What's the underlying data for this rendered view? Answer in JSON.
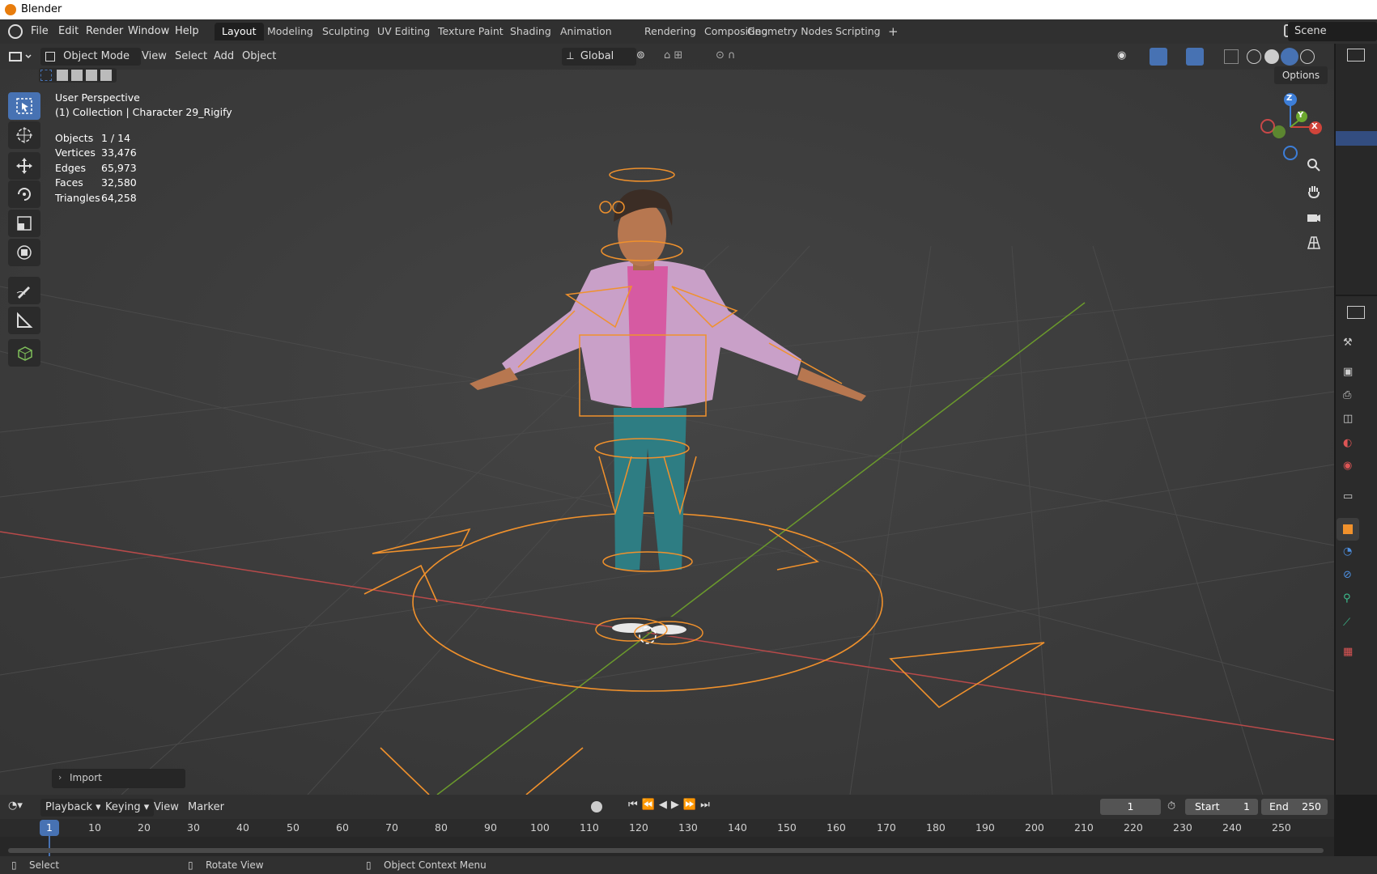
{
  "window": {
    "title": "Blender"
  },
  "menu": {
    "file": "File",
    "edit": "Edit",
    "render": "Render",
    "window": "Window",
    "help": "Help"
  },
  "workspaces": [
    "Layout",
    "Modeling",
    "Sculpting",
    "UV Editing",
    "Texture Paint",
    "Shading",
    "Animation",
    "Rendering",
    "Compositing",
    "Geometry Nodes",
    "Scripting"
  ],
  "add_workspace": "+",
  "scene": {
    "label": "Scene"
  },
  "viewport_header": {
    "mode": "Object Mode",
    "view": "View",
    "select": "Select",
    "add": "Add",
    "object": "Object",
    "orientation": "Global",
    "options": "Options"
  },
  "overlay_info": {
    "perspective": "User Perspective",
    "collection": "(1) Collection | Character 29_Rigify",
    "stats": [
      {
        "label": "Objects",
        "value": "1 / 14"
      },
      {
        "label": "Vertices",
        "value": "33,476"
      },
      {
        "label": "Edges",
        "value": "65,973"
      },
      {
        "label": "Faces",
        "value": "32,580"
      },
      {
        "label": "Triangles",
        "value": "64,258"
      }
    ]
  },
  "gizmo": {
    "z": "Z",
    "y": "Y",
    "x": "X"
  },
  "last_operation": "Import",
  "timeline_header": {
    "playback": "Playback",
    "keying": "Keying",
    "view": "View",
    "marker": "Marker",
    "current_frame": "1",
    "start_label": "Start",
    "start_value": "1",
    "end_label": "End",
    "end_value": "250"
  },
  "timeline_ticks": [
    "1",
    "10",
    "20",
    "30",
    "40",
    "50",
    "60",
    "70",
    "80",
    "90",
    "100",
    "110",
    "120",
    "130",
    "140",
    "150",
    "160",
    "170",
    "180",
    "190",
    "200",
    "210",
    "220",
    "230",
    "240",
    "250"
  ],
  "statusbar": {
    "select": "Select",
    "rotate": "Rotate View",
    "context": "Object Context Menu"
  },
  "colors": {
    "accent": "#4772b3",
    "selection": "#f0912c",
    "x_axis": "#b84a4a",
    "y_axis": "#6b9a2c"
  }
}
